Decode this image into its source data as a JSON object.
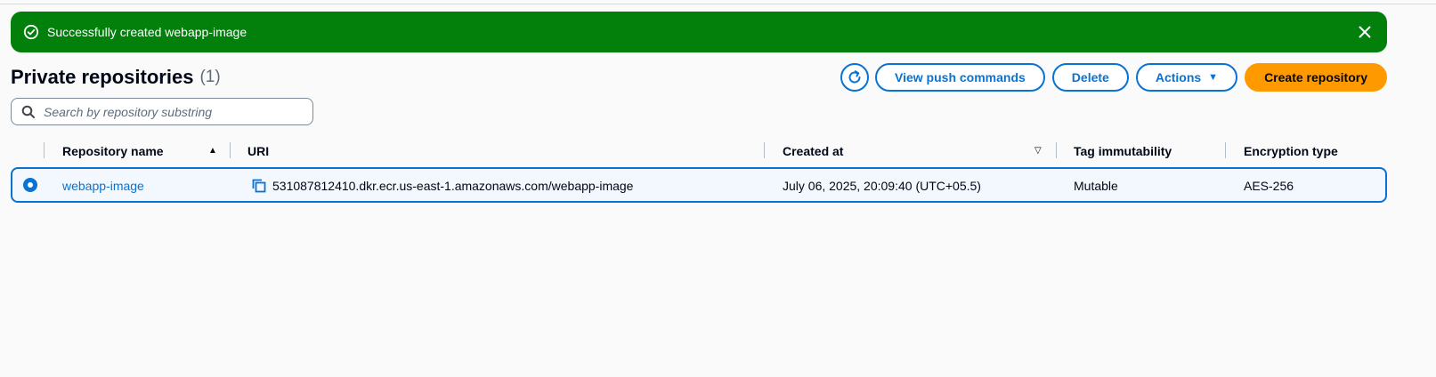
{
  "flash": {
    "message": "Successfully created webapp-image",
    "status_icon": "check-circle-icon",
    "dismiss_icon": "close-icon",
    "color": "#037f0c"
  },
  "header": {
    "title": "Private repositories",
    "count": "(1)"
  },
  "toolbar": {
    "refresh_icon": "refresh-icon",
    "view_push_commands": "View push commands",
    "delete": "Delete",
    "actions": "Actions",
    "create_repository": "Create repository",
    "primary_color": "#ff9900",
    "accent_color": "#0972d3"
  },
  "search": {
    "placeholder": "Search by repository substring"
  },
  "table": {
    "columns": {
      "name": "Repository name",
      "uri": "URI",
      "created": "Created at",
      "tag_immutability": "Tag immutability",
      "encryption": "Encryption type"
    },
    "rows": [
      {
        "selected": true,
        "name": "webapp-image",
        "uri": "531087812410.dkr.ecr.us-east-1.amazonaws.com/webapp-image",
        "created": "July 06, 2025, 20:09:40 (UTC+05.5)",
        "tag_immutability": "Mutable",
        "encryption": "AES-256"
      }
    ]
  }
}
